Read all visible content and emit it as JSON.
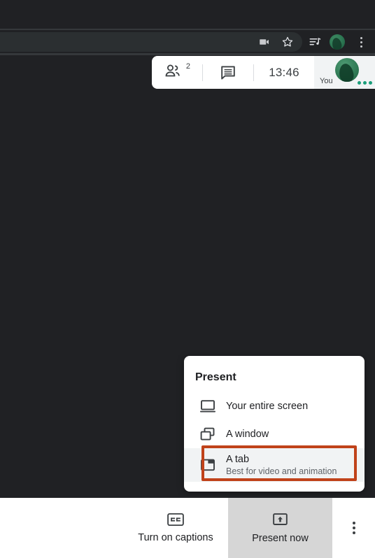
{
  "browser": {
    "toolbar_icons": [
      {
        "name": "video-camera-icon",
        "label": "Camera and microphone access"
      },
      {
        "name": "bookmark-star-icon",
        "label": "Bookmark this tab"
      },
      {
        "name": "media-playlist-icon",
        "label": "Media controls"
      },
      {
        "name": "profile-avatar-icon",
        "label": "Profile"
      },
      {
        "name": "chrome-menu-icon",
        "label": "Customize and control"
      }
    ]
  },
  "meeting_bar": {
    "participants_count": "2",
    "participants_icon": "people-icon",
    "chat_icon": "chat-bubble-icon",
    "time": "13:46",
    "self_label": "You",
    "speaking_indicator": "speaking-dots"
  },
  "present_popup": {
    "title": "Present",
    "options": [
      {
        "icon": "monitor-icon",
        "label": "Your entire screen",
        "sublabel": ""
      },
      {
        "icon": "window-icon",
        "label": "A window",
        "sublabel": ""
      },
      {
        "icon": "browser-tab-icon",
        "label": "A tab",
        "sublabel": "Best for video and animation"
      }
    ],
    "highlight_color": "#c0421a",
    "highlighted_option": "A tab"
  },
  "bottom_bar": {
    "captions": {
      "icon": "closed-captions-icon",
      "label": "Turn on captions"
    },
    "present_now": {
      "icon": "present-up-arrow-icon",
      "label": "Present now",
      "active_background": "#d6d6d6"
    },
    "more_options": {
      "icon": "more-vertical-icon"
    }
  },
  "colors": {
    "chrome_background": "#202124",
    "meet_canvas": "#202124",
    "panel_white": "#ffffff",
    "accent_green": "#1a9e7a",
    "highlight_orange": "#c0421a"
  }
}
